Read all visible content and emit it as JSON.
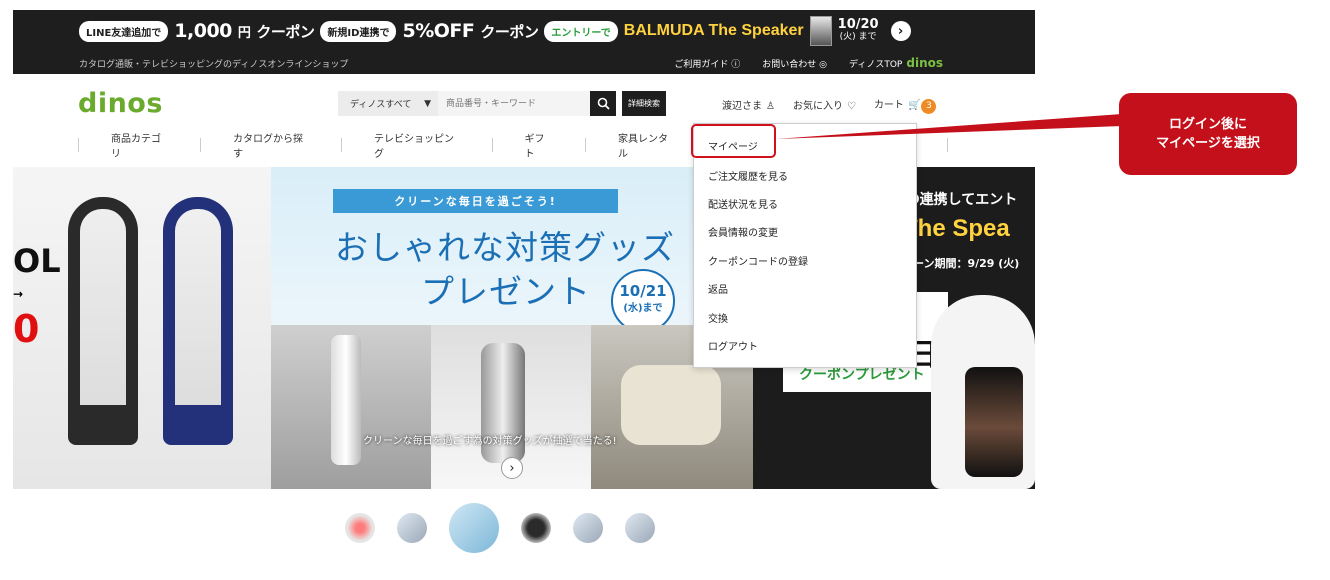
{
  "promo": {
    "line_badge": "LINE友達追加で",
    "coupon_amount": "1,000",
    "coupon_yen": "円",
    "coupon_label": "クーポン",
    "id_badge": "新規ID連携で",
    "discount": "5%OFF",
    "discount_label": "クーポン",
    "entry_badge": "エントリーで",
    "balmuda": "BALMUDA The Speaker",
    "deadline_date": "10/20",
    "deadline_sub": "(火) まで",
    "sub_left": "カタログ通販・テレビショッピングのディノスオンラインショップ",
    "guide": "ご利用ガイド ⓘ",
    "contact": "お問い合わせ",
    "top": "ディノスTOP",
    "top_logo": "dinos"
  },
  "header": {
    "logo": "dinos",
    "search_category": "ディノスすべて",
    "search_placeholder": "商品番号・キーワード",
    "advanced_search": "詳細検索",
    "user_name": "渡辺さま",
    "favorites": "お気に入り",
    "cart": "カート",
    "cart_count": "3"
  },
  "nav": {
    "items": [
      "商品カテゴリ",
      "カタログから探す",
      "テレビショッピング",
      "ギフト",
      "家具レンタル"
    ]
  },
  "dropdown": {
    "items": [
      "マイページ",
      "ご注文履歴を見る",
      "配送状況を見る",
      "会員情報の変更",
      "クーポンコードの登録",
      "返品",
      "交換",
      "ログアウト"
    ]
  },
  "hero": {
    "left_text": "OL",
    "left_arrow": "→",
    "left_red": "0",
    "ribbon": "クリーンな毎日を過ごそう!",
    "title_line1": "おしゃれな対策グッズ",
    "title_line2": "プレゼント",
    "date": "10/21",
    "date_sub": "(水)まで",
    "caption": "クリーンな毎日を過ごす為の対策グッズが抽選で当たる!",
    "right_line1": "D連携してエント",
    "right_line2": "The Spea",
    "right_line3": "ーン期間：9/29 (火)",
    "right_big": "日",
    "right_coupon": "クーポンプレゼント"
  },
  "callout": {
    "line1": "ログイン後に",
    "line2": "マイページを選択"
  },
  "colors": {
    "brand_green": "#6aaa2c",
    "callout_red": "#c4101a",
    "promo_bg": "#1e1e1e",
    "accent_yellow": "#ffd23f"
  }
}
